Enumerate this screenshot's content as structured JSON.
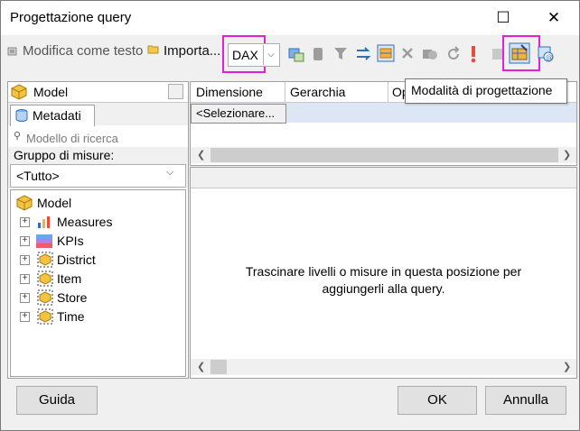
{
  "window": {
    "title": "Progettazione query",
    "maximize_glyph": "☐",
    "close_glyph": "✕"
  },
  "toolbar": {
    "edit_as_text": "Modifica come testo",
    "import": "Importa...",
    "dax": "DAX",
    "tooltip": "Modalità di progettazione"
  },
  "left_panel": {
    "cube_name": "Model",
    "tab_metadata": "Metadati",
    "search_placeholder": "Modello di ricerca",
    "measure_group_label": "Gruppo di misure:",
    "measure_group_value": "<Tutto>",
    "tree": {
      "root": "Model",
      "items": [
        "Measures",
        "KPIs",
        "District",
        "Item",
        "Store",
        "Time"
      ]
    }
  },
  "filter_grid": {
    "columns": [
      "Dimensione",
      "Gerarchia",
      "Op"
    ],
    "select_cell": "<Selezionare..."
  },
  "data_area": {
    "drop_message_line1": "Trascinare livelli o misure in questa posizione per",
    "drop_message_line2": "aggiungerli alla query."
  },
  "footer": {
    "help": "Guida",
    "ok": "OK",
    "cancel": "Annulla"
  },
  "colors": {
    "highlight": "#e61ed7",
    "window_bg": "#f0f0f0",
    "selection_bg": "#dce6f4"
  }
}
